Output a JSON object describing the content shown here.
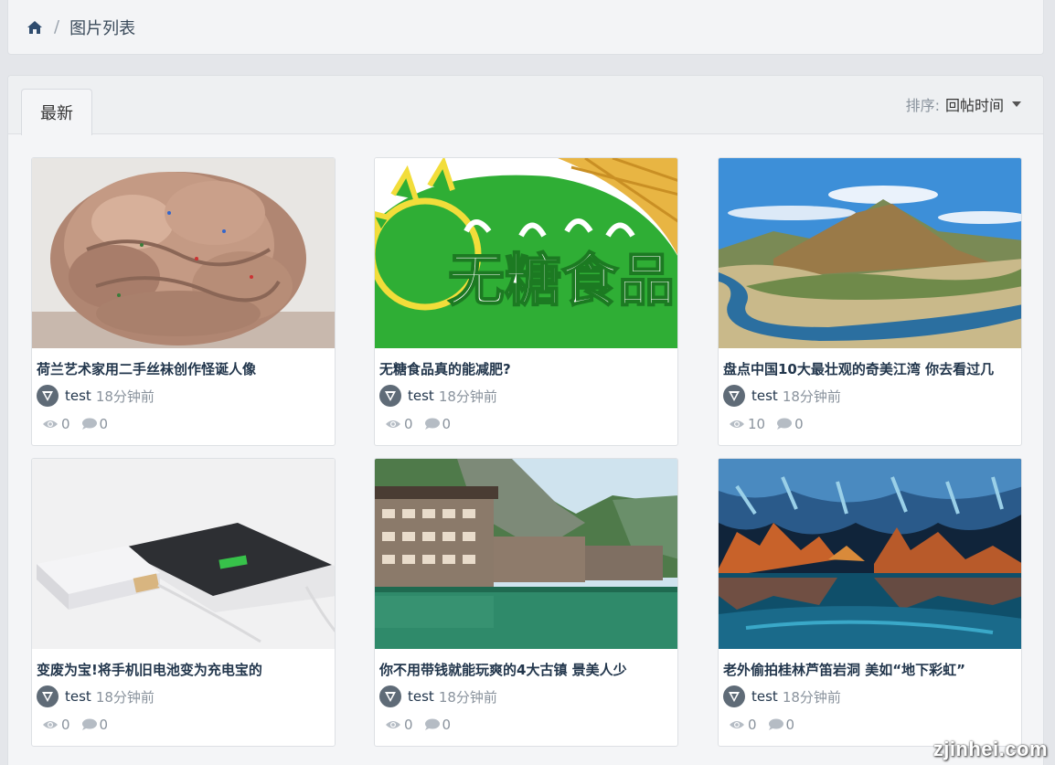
{
  "breadcrumb": {
    "home_icon": "home-icon",
    "separator": "/",
    "current": "图片列表"
  },
  "tabs": [
    {
      "label": "最新"
    }
  ],
  "sort": {
    "label": "排序:",
    "value": "回帖时间"
  },
  "cards": [
    {
      "title": "荷兰艺术家用二手丝袜创作怪诞人像",
      "author": "test",
      "time": "18分钟前",
      "views": "0",
      "comments": "0",
      "image": "sculpture-photo"
    },
    {
      "title": "无糖食品真的能减肥?",
      "author": "test",
      "time": "18分钟前",
      "views": "0",
      "comments": "0",
      "image": "sugar-free-logo",
      "image_text": "无糖食品"
    },
    {
      "title": "盘点中国10大最壮观的奇美江湾 你去看过几",
      "author": "test",
      "time": "18分钟前",
      "views": "10",
      "comments": "0",
      "image": "river-bend-photo"
    },
    {
      "title": "变废为宝!将手机旧电池变为充电宝的",
      "author": "test",
      "time": "18分钟前",
      "views": "0",
      "comments": "0",
      "image": "power-bank-photo"
    },
    {
      "title": "你不用带钱就能玩爽的4大古镇 景美人少",
      "author": "test",
      "time": "18分钟前",
      "views": "0",
      "comments": "0",
      "image": "ancient-town-photo"
    },
    {
      "title": "老外偷拍桂林芦笛岩洞 美如“地下彩虹”",
      "author": "test",
      "time": "18分钟前",
      "views": "0",
      "comments": "0",
      "image": "cave-photo"
    }
  ],
  "watermark": "zjinhei.com",
  "colors": {
    "link": "#22364c",
    "muted": "#8a939d",
    "green": "#2fae35",
    "yellow": "#f2dd3a"
  }
}
